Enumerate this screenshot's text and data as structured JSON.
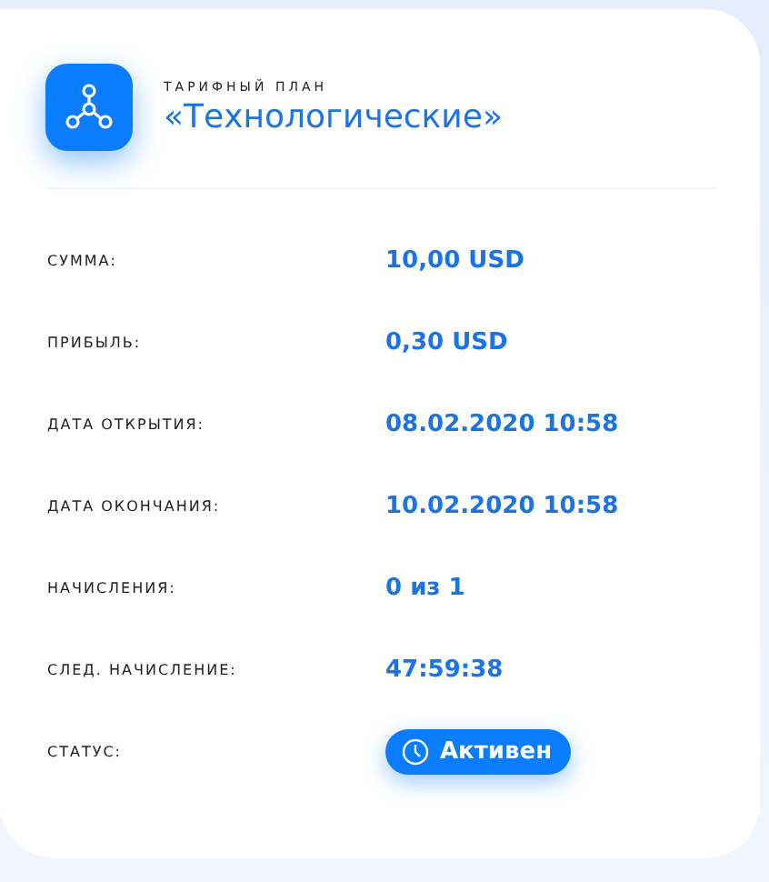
{
  "plan": {
    "caption": "ТАРИФНЫЙ ПЛАН",
    "title": "«Технологические»"
  },
  "rows": [
    {
      "kind": "text",
      "label": "СУММА:",
      "value": "10,00 USD"
    },
    {
      "kind": "text",
      "label": "ПРИБЫЛЬ:",
      "value": "0,30 USD"
    },
    {
      "kind": "text",
      "label": "ДАТА ОТКРЫТИЯ:",
      "value": "08.02.2020 10:58"
    },
    {
      "kind": "text",
      "label": "ДАТА ОКОНЧАНИЯ:",
      "value": "10.02.2020 10:58"
    },
    {
      "kind": "text",
      "label": "НАЧИСЛЕНИЯ:",
      "value": "0 из 1"
    },
    {
      "kind": "text",
      "label": "СЛЕД. НАЧИСЛЕНИЕ:",
      "value": "47:59:38"
    },
    {
      "kind": "badge",
      "label": "СТАТУС:",
      "value": "Активен"
    }
  ]
}
